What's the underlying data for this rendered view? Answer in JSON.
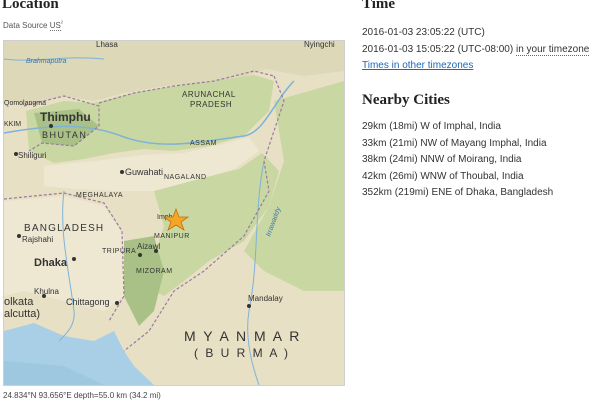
{
  "location": {
    "heading": "Location",
    "data_source_prefix": "Data Source",
    "data_source_link": "US",
    "data_source_sup": "²",
    "coordinates": "24.834°N 93.656°E depth=55.0 km (34.2 mi)"
  },
  "map": {
    "labels": {
      "lhasa": "Lhasa",
      "nyingchi": "Nyingchi",
      "brahmaputra": "Brahmaputra",
      "thimphu": "Thimphu",
      "bhutan": "BHUTAN",
      "arunachal": "ARUNACHAL",
      "pradesh": "PRADESH",
      "qomolangma": "Qomolangma",
      "kkim": "KKIM",
      "shiliguri": "Shiliguri",
      "guwahati": "Guwahati",
      "assam": "ASSAM",
      "meghalaya": "MEGHALAYA",
      "nagaland": "NAGALAND",
      "bangladesh": "BANGLADESH",
      "imphal": "Imphal",
      "manipur": "MANIPUR",
      "tripura": "TRIPURA",
      "aizawl": "Aizawl",
      "rajshahi": "Rajshahi",
      "dhaka": "Dhaka",
      "mizoram": "MIZORAM",
      "khulna": "Khulna",
      "kolkata": "olkata",
      "calcutta": "alcutta)",
      "chittagong": "Chittagong",
      "irrawaddy": "Irrawaddy",
      "mandalay": "Mandalay",
      "myanmar": "M Y A N M A R",
      "burma": "( B U R M A )"
    },
    "colors": {
      "land": "#e8e0c4",
      "plain": "#eee8d2",
      "green": "#c9d7a3",
      "dark_green": "#a9c187",
      "tibet": "#dcd8b8",
      "water": "#a8cfe6",
      "deep_water": "#9ec7e0",
      "river": "#7db3d8",
      "border": "#9a7aa0",
      "star": "#f5a623"
    }
  },
  "time": {
    "heading": "Time",
    "utc": "2016-01-03 23:05:22 (UTC)",
    "local": "2016-01-03 15:05:22 (UTC-08:00)",
    "local_suffix": "in your timezone",
    "other_link": "Times in other timezones"
  },
  "nearby": {
    "heading": "Nearby Cities",
    "cities": [
      "29km (18mi) W of Imphal, India",
      "33km (21mi) NW of Mayang Imphal, India",
      "38km (24mi) NNW of Moirang, India",
      "42km (26mi) WNW of Thoubal, India",
      "352km (219mi) ENE of Dhaka, Bangladesh"
    ]
  }
}
